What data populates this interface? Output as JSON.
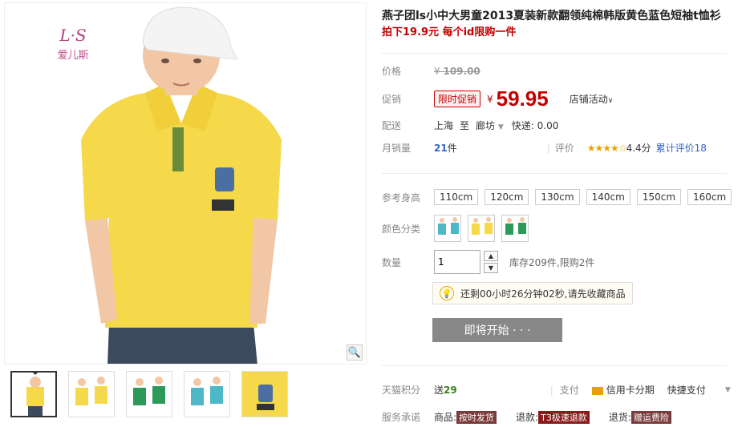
{
  "brand": {
    "emblem": "L·S",
    "name": "爱儿斯"
  },
  "product": {
    "title": "燕子团ls小中大男童2013夏装新款翻领纯棉韩版黄色蓝色短袖t恤衫",
    "subtitle": "拍下19.9元 每个id限购一件"
  },
  "price": {
    "label": "价格",
    "yen": "¥",
    "original": "109.00"
  },
  "promo": {
    "label": "促销",
    "tag": "限时促销",
    "yen": "¥",
    "value": "59.95",
    "shop_activity": "店铺活动"
  },
  "shipping": {
    "label": "配送",
    "from": "上海",
    "to_word": "至",
    "to": "廊坊",
    "express": "快递: 0.00"
  },
  "sales": {
    "label": "月销量",
    "count": "21",
    "unit": "件",
    "rating_label": "评价",
    "stars": "★★★★☆",
    "score": "4.4分",
    "reviews": "累计评价18"
  },
  "height": {
    "label": "参考身高",
    "options": [
      "110cm",
      "120cm",
      "130cm",
      "140cm",
      "150cm",
      "160cm"
    ]
  },
  "colors": {
    "label": "颜色分类"
  },
  "quantity": {
    "label": "数量",
    "value": "1",
    "stock": "库存209件,限购2件"
  },
  "notice": {
    "text": "还剩00小时26分钟02秒,请先收藏商品"
  },
  "start_button": {
    "label": "即将开始 · · ·"
  },
  "points": {
    "label": "天猫积分",
    "prefix": "送",
    "value": "29",
    "pay_label": "支付",
    "credit": "信用卡分期",
    "quick": "快捷支付"
  },
  "service": {
    "label": "服务承诺",
    "goods": "商品:",
    "goods_badge": "按时发货",
    "refund": "退款:",
    "refund_badge": "T3极速退款",
    "return": "退货:",
    "return_badge": "赠运费险"
  },
  "colors_theme": {
    "accent": "#c40000",
    "star": "#e8a200"
  }
}
